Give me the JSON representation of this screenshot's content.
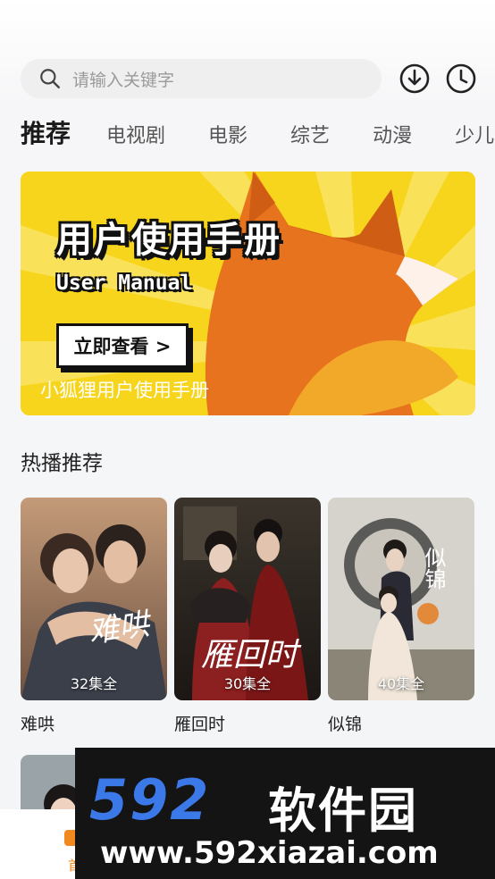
{
  "search": {
    "placeholder": "请输入关键字"
  },
  "header_icons": [
    "download-icon",
    "history-icon"
  ],
  "tabs": [
    {
      "label": "推荐",
      "active": true
    },
    {
      "label": "电视剧"
    },
    {
      "label": "电影"
    },
    {
      "label": "综艺"
    },
    {
      "label": "动漫"
    },
    {
      "label": "少儿"
    }
  ],
  "banner": {
    "title": "用户使用手册",
    "subtitle": "User Manual",
    "button_label": "立即查看 >",
    "caption": "小狐狸用户使用手册"
  },
  "section": {
    "title": "热播推荐"
  },
  "cards": [
    {
      "title": "难哄",
      "episodes": "32集全",
      "calligraphy": "难哄"
    },
    {
      "title": "雁回时",
      "episodes": "30集全",
      "calligraphy": "雁回时"
    },
    {
      "title": "似锦",
      "episodes": "40集全",
      "calligraphy": "似锦"
    }
  ],
  "bottom_nav": {
    "home_label": "首"
  },
  "watermark": {
    "logo": "592",
    "name": "软件园",
    "url": "www.592xiazai.com"
  },
  "colors": {
    "accent": "#f08a20",
    "banner_yellow": "#f6d51c",
    "fox_orange": "#e8731e"
  }
}
